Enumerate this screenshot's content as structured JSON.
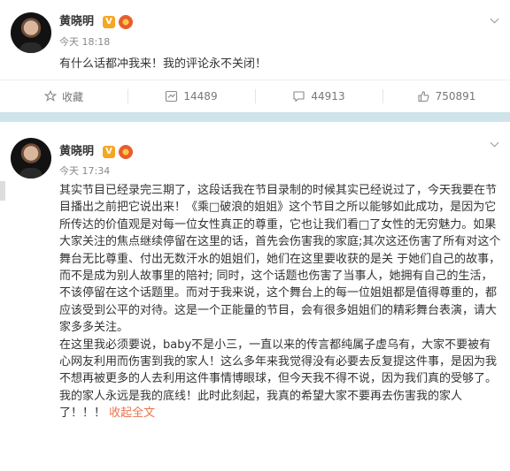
{
  "post1": {
    "author": "黄晓明",
    "vip_badge": "V",
    "time": "今天 18:18",
    "text": "有什么话都冲我来！我的评论永不关闭！",
    "actions": {
      "favorite_label": "收藏",
      "repost_count": "14489",
      "comment_count": "44913",
      "like_count": "750891"
    }
  },
  "post2": {
    "author": "黄晓明",
    "vip_badge": "V",
    "time": "今天 17:34",
    "paragraph1": "其实节目已经录完三期了，这段话我在节目录制的时候其实已经说过了，今天我要在节目播出之前把它说出来！《乘□破浪的姐姐》这个节目之所以能够如此成功，是因为它所传达的价值观是对每一位女性真正的尊重，它也让我们看□了女性的无穷魅力。如果大家关注的焦点继续停留在这里的话，首先会伤害我的家庭;其次这还伤害了所有对这个舞台无比尊重、付出无数汗水的姐姐们，她们在这里要收获的是关 于她们自己的故事，而不是成为别人故事里的陪衬; 同时，这个话题也伤害了当事人，她拥有自己的生活，不该停留在这个话题里。而对于我来说，这个舞台上的每一位姐姐都是值得尊重的，都应该受到公平的对待。这是一个正能量的节目，会有很多姐姐们的精彩舞台表演，请大家多多关注。",
    "paragraph2": "在这里我必须要说，baby不是小三，一直以来的传言都纯属子虚乌有，大家不要被有心网友利用而伤害到我的家人！这么多年来我觉得没有必要去反复提这件事，是因为我不想再被更多的人去利用这件事情博眼球，但今天我不得不说，因为我们真的受够了。我的家人永远是我的底线！此时此刻起，我真的希望大家不要再去伤害我的家人了！！！",
    "collapse_label": "收起全文"
  },
  "colors": {
    "divider": "#cfe4ea",
    "vip": "#f5a623",
    "link": "#eb7350"
  },
  "icons": [
    "chevron-down-icon",
    "star-icon",
    "repost-icon",
    "comment-icon",
    "like-icon",
    "vip-badge-icon",
    "fan-badge-icon"
  ]
}
